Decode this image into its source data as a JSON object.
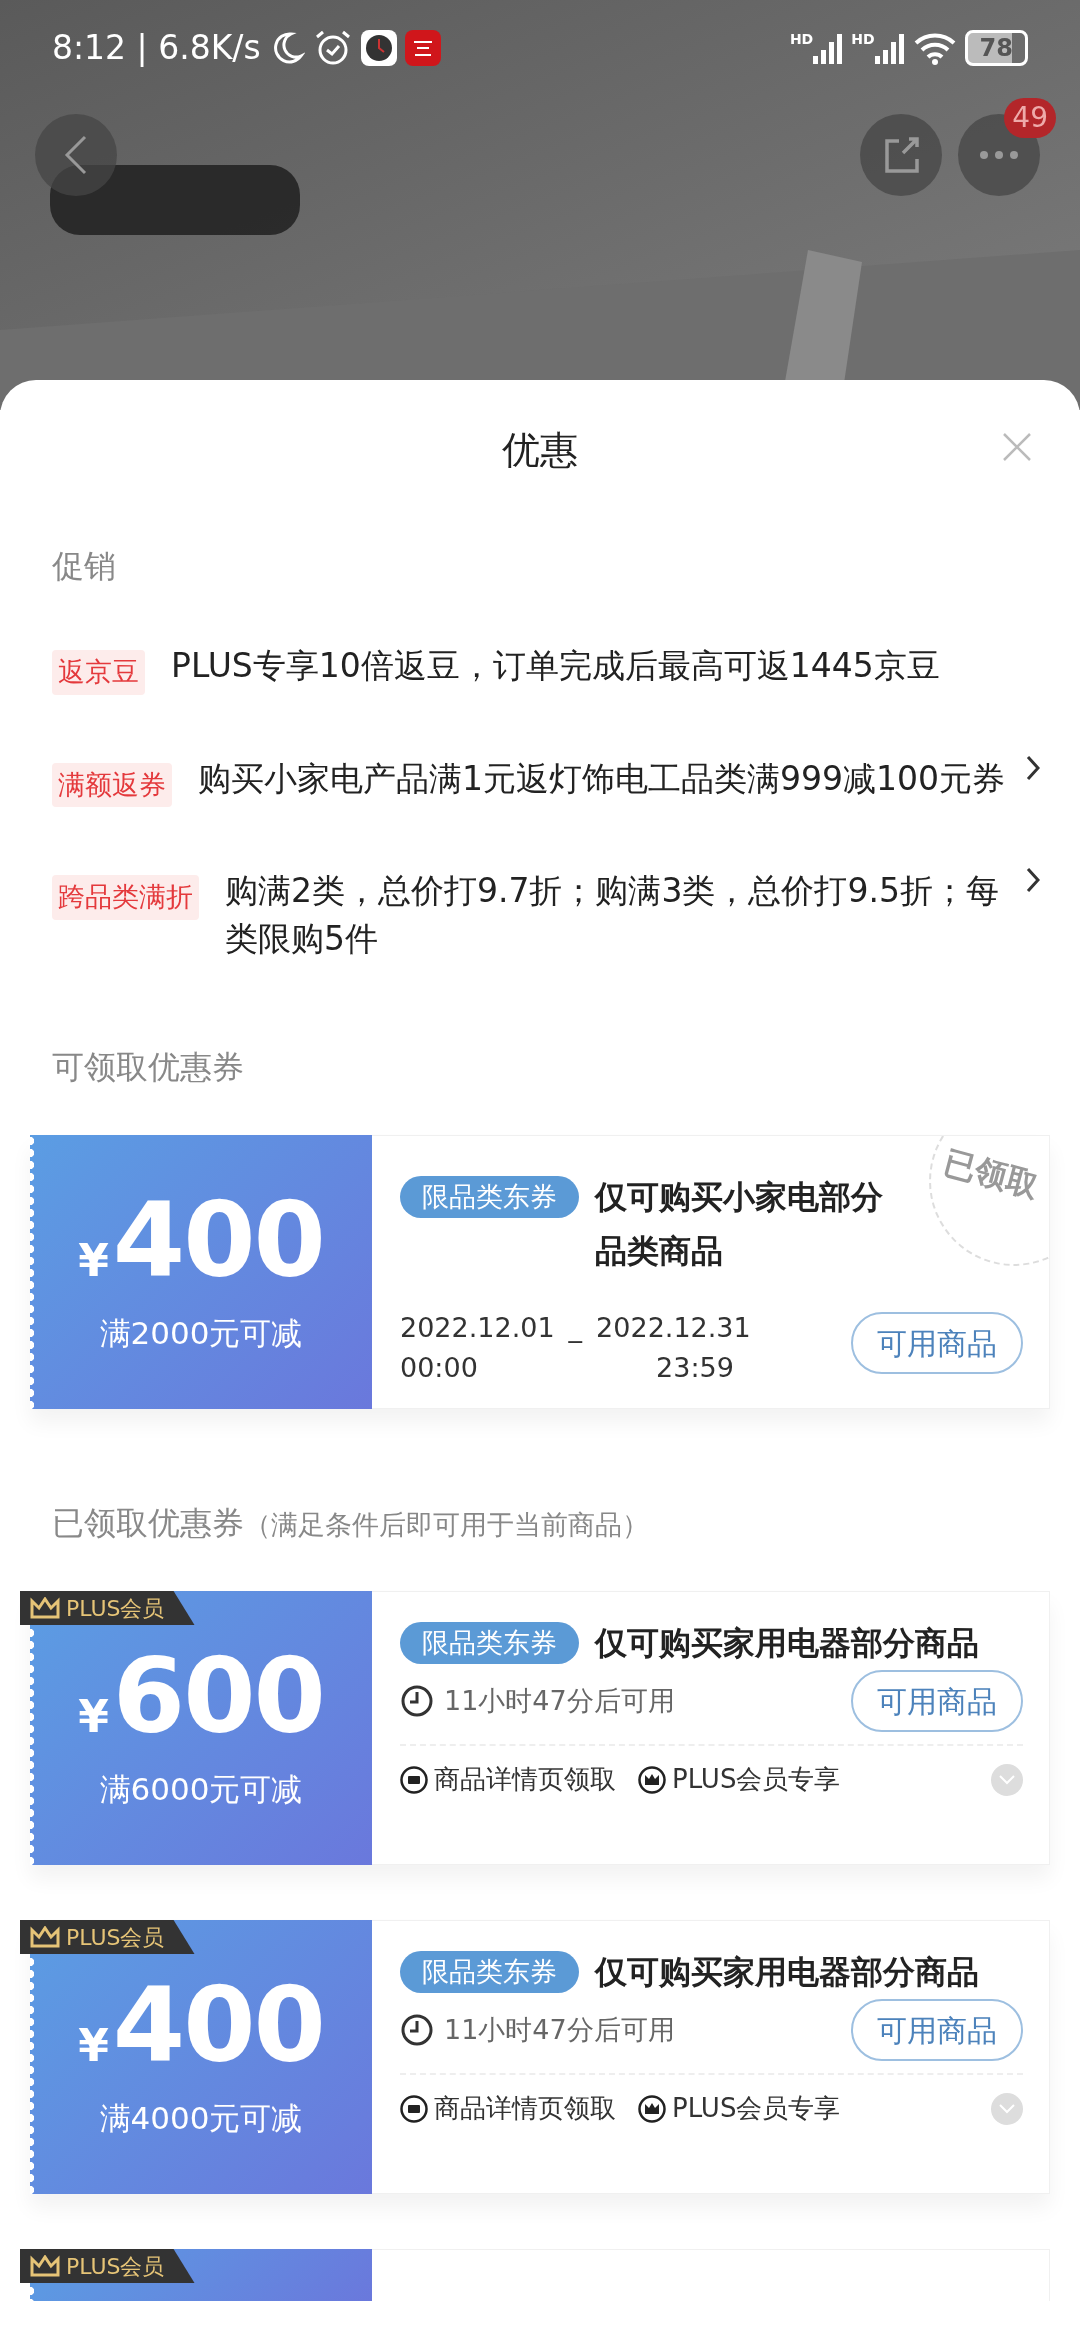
{
  "status_bar": {
    "time": "8:12 | 6.8K/s",
    "signal_labels": [
      "HD",
      "HD"
    ],
    "battery": "78"
  },
  "header": {
    "more_badge": "49"
  },
  "sheet": {
    "title": "优惠"
  },
  "promotions": {
    "heading": "促销",
    "items": [
      {
        "tag": "返京豆",
        "text": "PLUS专享10倍返豆，订单完成后最高可返1445京豆",
        "has_arrow": false
      },
      {
        "tag": "满额返券",
        "text": "购买小家电产品满1元返灯饰电工品类满999减100元券",
        "has_arrow": true
      },
      {
        "tag": "跨品类满折",
        "text": "购满2类，总价打9.7折；购满3类，总价打9.5折；每类限购5件",
        "has_arrow": true
      }
    ]
  },
  "available_coupons": {
    "heading": "可领取优惠券",
    "items": [
      {
        "currency": "¥",
        "amount": "400",
        "condition": "满2000元可减",
        "tag": "限品类东券",
        "title": "仅可购买小家电部分品类商品",
        "start_date": "2022.12.01",
        "start_time": "00:00",
        "separator": "_",
        "end_date": "2022.12.31",
        "end_time": "23:59",
        "button": "可用商品",
        "stamp": "已领取"
      }
    ]
  },
  "claimed_coupons": {
    "heading": "已领取优惠券",
    "note": "（满足条件后即可用于当前商品）",
    "items": [
      {
        "plus_badge": "PLUS会员",
        "currency": "¥",
        "amount": "600",
        "condition": "满6000元可减",
        "tag": "限品类东券",
        "title": "仅可购买家用电器部分商品",
        "countdown": "11小时47分后可用",
        "button": "可用商品",
        "features": [
          {
            "kind": "page",
            "text": "商品详情页领取"
          },
          {
            "kind": "plus",
            "text": "PLUS会员专享"
          }
        ],
        "expanded": false
      },
      {
        "plus_badge": "PLUS会员",
        "currency": "¥",
        "amount": "400",
        "condition": "满4000元可减",
        "tag": "限品类东券",
        "title": "仅可购买家用电器部分商品",
        "countdown": "11小时47分后可用",
        "button": "可用商品",
        "features": [
          {
            "kind": "page",
            "text": "商品详情页领取"
          },
          {
            "kind": "plus",
            "text": "PLUS会员专享"
          }
        ],
        "expanded": false
      },
      {
        "plus_badge": "PLUS会员"
      }
    ]
  }
}
